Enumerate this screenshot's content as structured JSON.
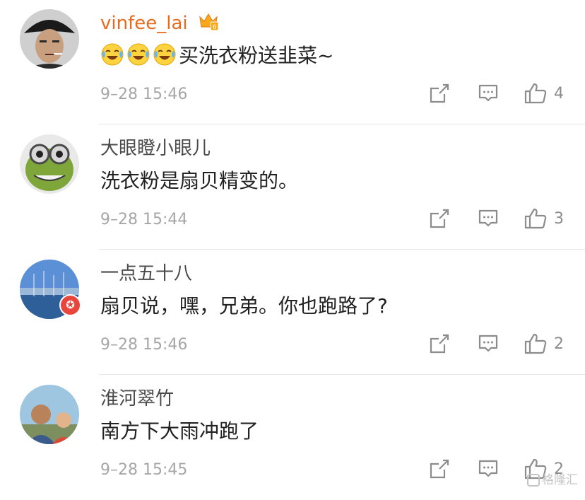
{
  "comments": [
    {
      "username": "vinfee_lai",
      "vip": true,
      "emoji_count": 3,
      "emoji_icon": "laughing-crying-emoji",
      "text": "买洗衣粉送韭菜~",
      "time": "9–28 15:46",
      "likes": "4"
    },
    {
      "username": "大眼瞪小眼儿",
      "vip": false,
      "text": "洗衣粉是扇贝精变的。",
      "time": "9–28 15:44",
      "likes": "3"
    },
    {
      "username": "一点五十八",
      "vip": false,
      "has_badge": true,
      "text": "扇贝说，嘿，兄弟。你也跑路了?",
      "time": "9–28 15:46",
      "likes": "2"
    },
    {
      "username": "淮河翠竹",
      "vip": false,
      "text": "南方下大雨冲跑了",
      "time": "9–28 15:45",
      "likes": "2"
    }
  ],
  "icons": {
    "share": "share-icon",
    "reply": "comment-icon",
    "like": "thumbs-up-icon",
    "crown": "vip-crown-icon",
    "badge": "verified-badge-icon"
  },
  "colors": {
    "vip_name": "#e86b1f",
    "name": "#4a4a4a",
    "text": "#222222",
    "meta": "#a6a6a6",
    "badge": "#e8453c"
  },
  "watermark": "格隆汇"
}
